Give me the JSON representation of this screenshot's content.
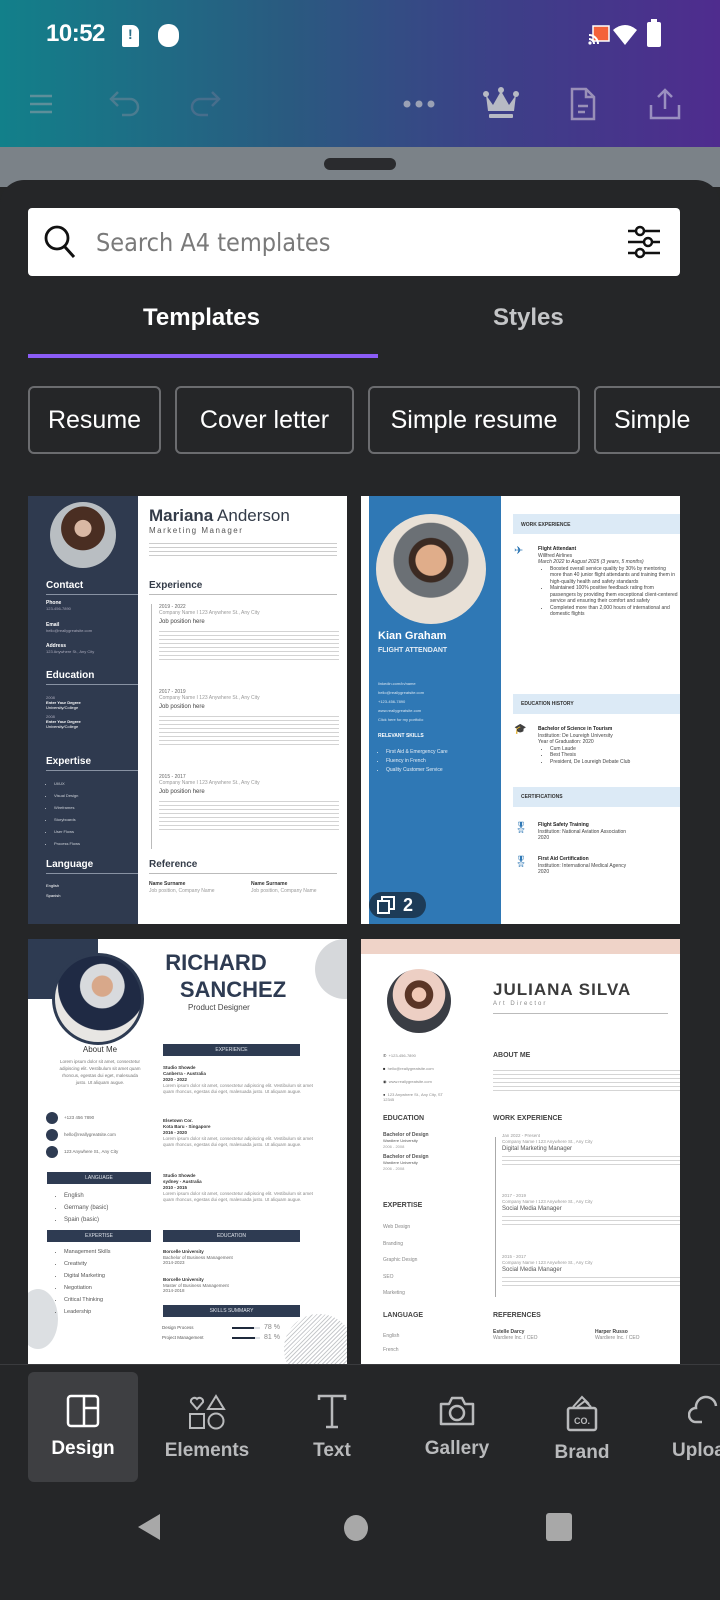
{
  "status_bar": {
    "time": "10:52",
    "icons": [
      "sim-alert-icon",
      "notification-dot-icon",
      "cast-icon",
      "wifi-icon",
      "battery-icon"
    ]
  },
  "toolbar": {
    "left_icons": [
      "menu-icon",
      "undo-icon",
      "redo-icon"
    ],
    "right_icons": [
      "more-icon",
      "crown-icon",
      "document-icon",
      "share-icon"
    ]
  },
  "search": {
    "placeholder": "Search A4 templates",
    "value": ""
  },
  "tabs": [
    {
      "label": "Templates",
      "active": true
    },
    {
      "label": "Styles",
      "active": false
    }
  ],
  "chips": [
    "Resume",
    "Cover letter",
    "Simple resume",
    "Simple"
  ],
  "templates": [
    {
      "name": "Mariana Anderson",
      "first": "Mariana",
      "last": "Anderson",
      "role": "Marketing Manager",
      "sections": {
        "contact": "Contact",
        "phone_label": "Phone",
        "phone": "123-456-7890",
        "email_label": "Email",
        "email": "hello@reallygreatsite.com",
        "address_label": "Address",
        "address": "123 Anywhere St., Any City",
        "education": "Education",
        "edu": [
          {
            "year": "2008",
            "degree": "Enter Your Degree",
            "school": "University/College"
          },
          {
            "year": "2008",
            "degree": "Enter Your Degree",
            "school": "University/College"
          }
        ],
        "expertise": "Expertise",
        "expertise_items": [
          "UI/UX",
          "Visual Design",
          "Wireframes",
          "Storyboards",
          "User Flows",
          "Process Flows"
        ],
        "language": "Language",
        "languages": [
          "English",
          "Spanish"
        ],
        "experience": "Experience",
        "jobs": [
          {
            "years": "2019 - 2022",
            "company": "Company Name I 123 Anywhere St., Any City",
            "title": "Job position here"
          },
          {
            "years": "2017 - 2019",
            "company": "Company Name I 123 Anywhere St., Any City",
            "title": "Job position here"
          },
          {
            "years": "2015 - 2017",
            "company": "Company Name I 123 Anywhere St., Any City",
            "title": "Job position here"
          }
        ],
        "reference": "Reference",
        "refs": [
          {
            "name": "Name Surname",
            "pos": "Job position, Company Name"
          },
          {
            "name": "Name Surname",
            "pos": "Job position, Company Name"
          }
        ]
      }
    },
    {
      "name": "Kian Graham",
      "role": "Flight Attendant",
      "page_count": "2",
      "contacts": [
        "linkedin.com/in/name",
        "hello@reallygreatsite.com",
        "+123-456-7890",
        "www.reallygreatsite.com",
        "Click here for my portfolio"
      ],
      "skills_title": "Relevant Skills",
      "skills": [
        "First Aid & Emergency Care",
        "Fluency in French",
        "Quality Customer Service"
      ],
      "work_title": "Work Experience",
      "job_title": "Flight Attendant",
      "job_company": "Willfred Airlines",
      "job_dates": "March 2022 to August 2025 (3 years, 5 months)",
      "job_bullets": [
        "Boosted overall service quality by 30% by mentoring more than 40 junior flight attendants and training them in high-quality health and safety standards",
        "Maintained 100% positive feedback rating from passengers by providing them exceptional client-centered service and ensuring their comfort and safety",
        "Completed more than 2,000 hours of international and domestic flights"
      ],
      "edu_title": "Education History",
      "degree": "Bachelor of Science in Tourism",
      "institution": "Institution: De Loureigh University",
      "grad": "Year of Graduation: 2020",
      "honors": [
        "Cum Laude",
        "Best Thesis",
        "President, De Loureigh Debate Club"
      ],
      "cert_title": "Certifications",
      "certs": [
        {
          "name": "Flight Safety Training",
          "inst": "Institution: National Aviation Association",
          "year": "2020"
        },
        {
          "name": "First Aid Certification",
          "inst": "Institution: International Medical Agency",
          "year": "2020"
        }
      ]
    },
    {
      "first": "RICHARD",
      "last": "SANCHEZ",
      "role": "Product Designer",
      "about_title": "About Me",
      "about": "Lorem ipsum dolor sit amet, consectetur adipiscing elit. Vestibulum sit amet quam rhoncus, egestas dui eget, malesuada justo. Ut aliquam augue.",
      "phone": "+123 456 7890",
      "email": "hello@reallygreatsite.com",
      "address": "123 Anywhere St., Any City",
      "language_title": "LANGUAGE",
      "languages": [
        "English",
        "Germany (basic)",
        "Spain (basic)"
      ],
      "expertise_title": "EXPERTISE",
      "expertise": [
        "Management Skills",
        "Creativity",
        "Digital Marketing",
        "Negotiation",
        "Critical Thinking",
        "Leadership"
      ],
      "experience_title": "EXPERIENCE",
      "jobs": [
        {
          "company": "Studio Showde",
          "place": "Canberra - Australia",
          "years": "2020 - 2022"
        },
        {
          "company": "Elsetown Cor.",
          "place": "Kota Baru - Singapore",
          "years": "2016 - 2020"
        },
        {
          "company": "Studio Showde",
          "place": "sydney - Australia",
          "years": "2010 - 2015"
        }
      ],
      "job_desc": "Lorem ipsum dolor sit amet, consectetur adipiscing elit. Vestibulum sit amet quam rhoncus, egestas dui eget, malesuada justo. Ut aliquam augue.",
      "education_title": "EDUCATION",
      "edu": [
        {
          "school": "Borcelle University",
          "degree": "Bachelor of Business Management",
          "years": "2014-2023"
        },
        {
          "school": "Borcelle University",
          "degree": "Master of Business Management",
          "years": "2014-2018"
        }
      ],
      "skills_title": "SKILLS SUMMARY",
      "skills": [
        {
          "name": "Design Process",
          "percent": 78,
          "label": "78 %"
        },
        {
          "name": "Project Management",
          "percent": 81,
          "label": "81 %"
        }
      ]
    },
    {
      "name": "JULIANA SILVA",
      "role": "Art Director",
      "contacts": [
        "+123-456-7890",
        "hello@reallygreatsite.com",
        "www.reallygreatsite.com",
        "123 Anywhere St., Any City, ST 12345"
      ],
      "education_title": "EDUCATION",
      "edu": [
        {
          "degree": "Bachelor of Design",
          "school": "Wardiere University",
          "years": "2006 - 2008"
        },
        {
          "degree": "Bachelor of Design",
          "school": "Wardiere University",
          "years": "2006 - 2008"
        }
      ],
      "expertise_title": "EXPERTISE",
      "expertise": [
        "Web Design",
        "Branding",
        "Graphic Design",
        "SEO",
        "Marketing"
      ],
      "language_title": "LANGUAGE",
      "languages": [
        "English",
        "French"
      ],
      "about_title": "ABOUT ME",
      "work_title": "WORK EXPERIENCE",
      "jobs": [
        {
          "years": "Jan 2022 - Present",
          "company": "Company Name I 123 Anywhere St., Any City",
          "title": "Digital Marketing Manager"
        },
        {
          "years": "2017 - 2019",
          "company": "Company Name I 123 Anywhere St., Any City",
          "title": "Social Media Manager"
        },
        {
          "years": "2015 - 2017",
          "company": "Company Name I 123 Anywhere St., Any City",
          "title": "Social Media Manager"
        }
      ],
      "references_title": "REFERENCES",
      "refs": [
        {
          "name": "Estelle Darcy",
          "pos": "Wardiere Inc. / CEO"
        },
        {
          "name": "Harper Russo",
          "pos": "Wardiere Inc. / CEO"
        }
      ]
    }
  ],
  "bottom_nav": [
    {
      "label": "Design",
      "icon": "layout-icon",
      "active": true
    },
    {
      "label": "Elements",
      "icon": "shapes-icon",
      "active": false
    },
    {
      "label": "Text",
      "icon": "text-icon",
      "active": false
    },
    {
      "label": "Gallery",
      "icon": "camera-icon",
      "active": false
    },
    {
      "label": "Brand",
      "icon": "brand-icon",
      "active": false
    },
    {
      "label": "Uploads",
      "icon": "upload-cloud-icon",
      "active": false
    }
  ],
  "system_nav": [
    "back-icon",
    "home-icon",
    "recents-icon"
  ],
  "colors": {
    "accent": "#8b5cf6",
    "sheet": "#252628",
    "navy": "#2f3b51",
    "blue": "#2f78b5"
  }
}
